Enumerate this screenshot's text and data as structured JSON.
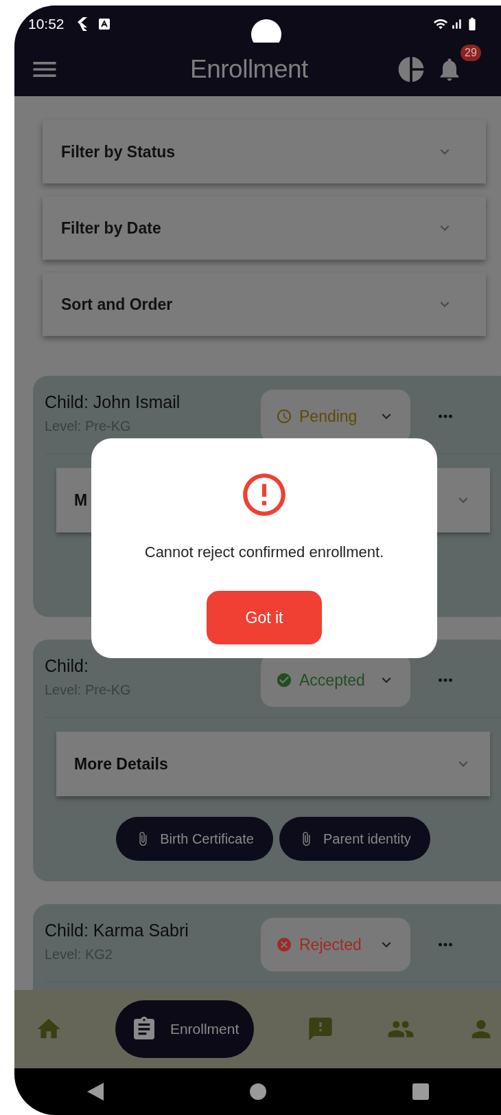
{
  "status_bar": {
    "time": "10:52"
  },
  "app_bar": {
    "title": "Enrollment",
    "notification_badge": "29"
  },
  "filters": [
    {
      "label": "Filter by Status"
    },
    {
      "label": "Filter by Date"
    },
    {
      "label": "Sort and Order"
    }
  ],
  "cards": [
    {
      "name": "Child: John Ismail",
      "level": "Level: Pre-KG",
      "status": {
        "kind": "pending",
        "label": "Pending"
      },
      "details_label": "M"
    },
    {
      "name": "Child:",
      "level": "Level: Pre-KG",
      "status": {
        "kind": "accepted",
        "label": "Accepted"
      },
      "details_label": "More Details",
      "documents": [
        "Birth Certificate",
        "Parent identity"
      ]
    },
    {
      "name": "Child: Karma Sabri",
      "level": "Level: KG2",
      "status": {
        "kind": "rejected",
        "label": "Rejected"
      }
    }
  ],
  "dialog": {
    "message": "Cannot reject confirmed enrollment.",
    "button": "Got it"
  },
  "bottom_nav": [
    {
      "kind": "home",
      "selected": false
    },
    {
      "kind": "enrollment",
      "label": "Enrollment",
      "selected": true
    },
    {
      "kind": "complaints",
      "selected": false
    },
    {
      "kind": "people",
      "selected": false
    },
    {
      "kind": "profile",
      "selected": false
    }
  ]
}
